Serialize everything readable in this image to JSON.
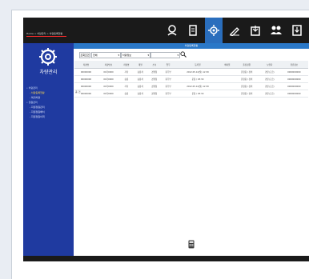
{
  "header": {
    "breadcrumb": "Home > 차량관리 > 차량등록현황",
    "icons": [
      "user-icon",
      "document-icon",
      "settings-icon",
      "pen-icon",
      "export-icon",
      "group-icon",
      "report-icon"
    ]
  },
  "sidebar": {
    "title": "차량관리",
    "menu": [
      {
        "label": "• 차량관리",
        "level": 0
      },
      {
        "label": "- 차량등록현황",
        "level": 1,
        "selected": true
      },
      {
        "label": "- 복귀차량",
        "level": 1
      },
      {
        "label": "• 정원관리",
        "level": 0
      },
      {
        "label": "- 지정정원관리",
        "level": 1
      },
      {
        "label": "- 지정정원배치",
        "level": 1
      },
      {
        "label": "- 지정정원이력",
        "level": 1
      }
    ]
  },
  "main": {
    "title": "차량등록현황",
    "filter": {
      "button_label": "조회조건",
      "select1": "전체",
      "select2": "차량정보",
      "select3": ""
    },
    "columns": [
      "차량명",
      "차량번호",
      "차량명",
      "계열",
      "소속",
      "업무",
      "등록일",
      "배치일",
      "출장정원",
      "보유자",
      "유류정보"
    ],
    "rows": [
      [
        "00000000",
        "00가0000",
        "기타",
        "승용차",
        "경찰청",
        "총무부",
        "2012.05.14(월) 12:30",
        "",
        "운영중 / 정비",
        "경유(고급)",
        "0000000000"
      ],
      [
        "00000000",
        "00가0000",
        "승용",
        "승용차",
        "경찰청",
        "총무부",
        "운용 / 03:30",
        "",
        "운영중 / 정비",
        "경유(고급)",
        "0000000000"
      ],
      [
        "00000000",
        "00가0000",
        "기타",
        "승용차",
        "경찰청",
        "총무부",
        "2012.05.14(월) 12:30",
        "",
        "운영중 / 정비",
        "경유(고급)",
        "0000000000"
      ],
      [
        "00000000",
        "00가0000",
        "승용",
        "승용차",
        "경찰청",
        "총무부",
        "운용 / 03:30",
        "",
        "운영중 / 정비",
        "경유(고급)",
        "0000000000"
      ]
    ],
    "footnote": "총 건"
  }
}
